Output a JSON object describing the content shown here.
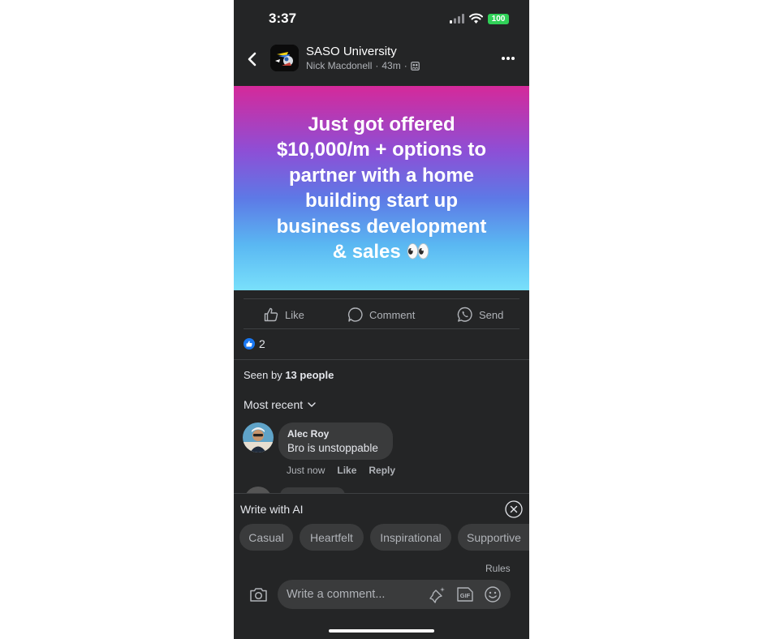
{
  "status_bar": {
    "time": "3:37",
    "battery": "100"
  },
  "header": {
    "group_name": "SASO University",
    "author": "Nick Macdonell",
    "separator": "·",
    "time_ago": "43m"
  },
  "post": {
    "text": "Just got offered\n$10,000/m + options  to\npartner with a home\nbuilding start up\nbusiness development\n& sales 👀"
  },
  "actions": {
    "like": "Like",
    "comment": "Comment",
    "send": "Send"
  },
  "reactions": {
    "count": "2"
  },
  "seen": {
    "prefix": "Seen by ",
    "count": "13 people"
  },
  "sort": {
    "label": "Most recent"
  },
  "comments": [
    {
      "author": "Alec Roy",
      "text": "Bro is unstoppable",
      "time": "Just now",
      "like": "Like",
      "reply": "Reply"
    }
  ],
  "ai_panel": {
    "title": "Write with AI",
    "chips": [
      "Casual",
      "Heartfelt",
      "Inspirational",
      "Supportive"
    ],
    "rules": "Rules",
    "input_placeholder": "Write a comment..."
  },
  "colors": {
    "background": "#242526",
    "bubble": "#3a3b3c",
    "battery": "#30d158",
    "like_blue": "#1877f2"
  }
}
